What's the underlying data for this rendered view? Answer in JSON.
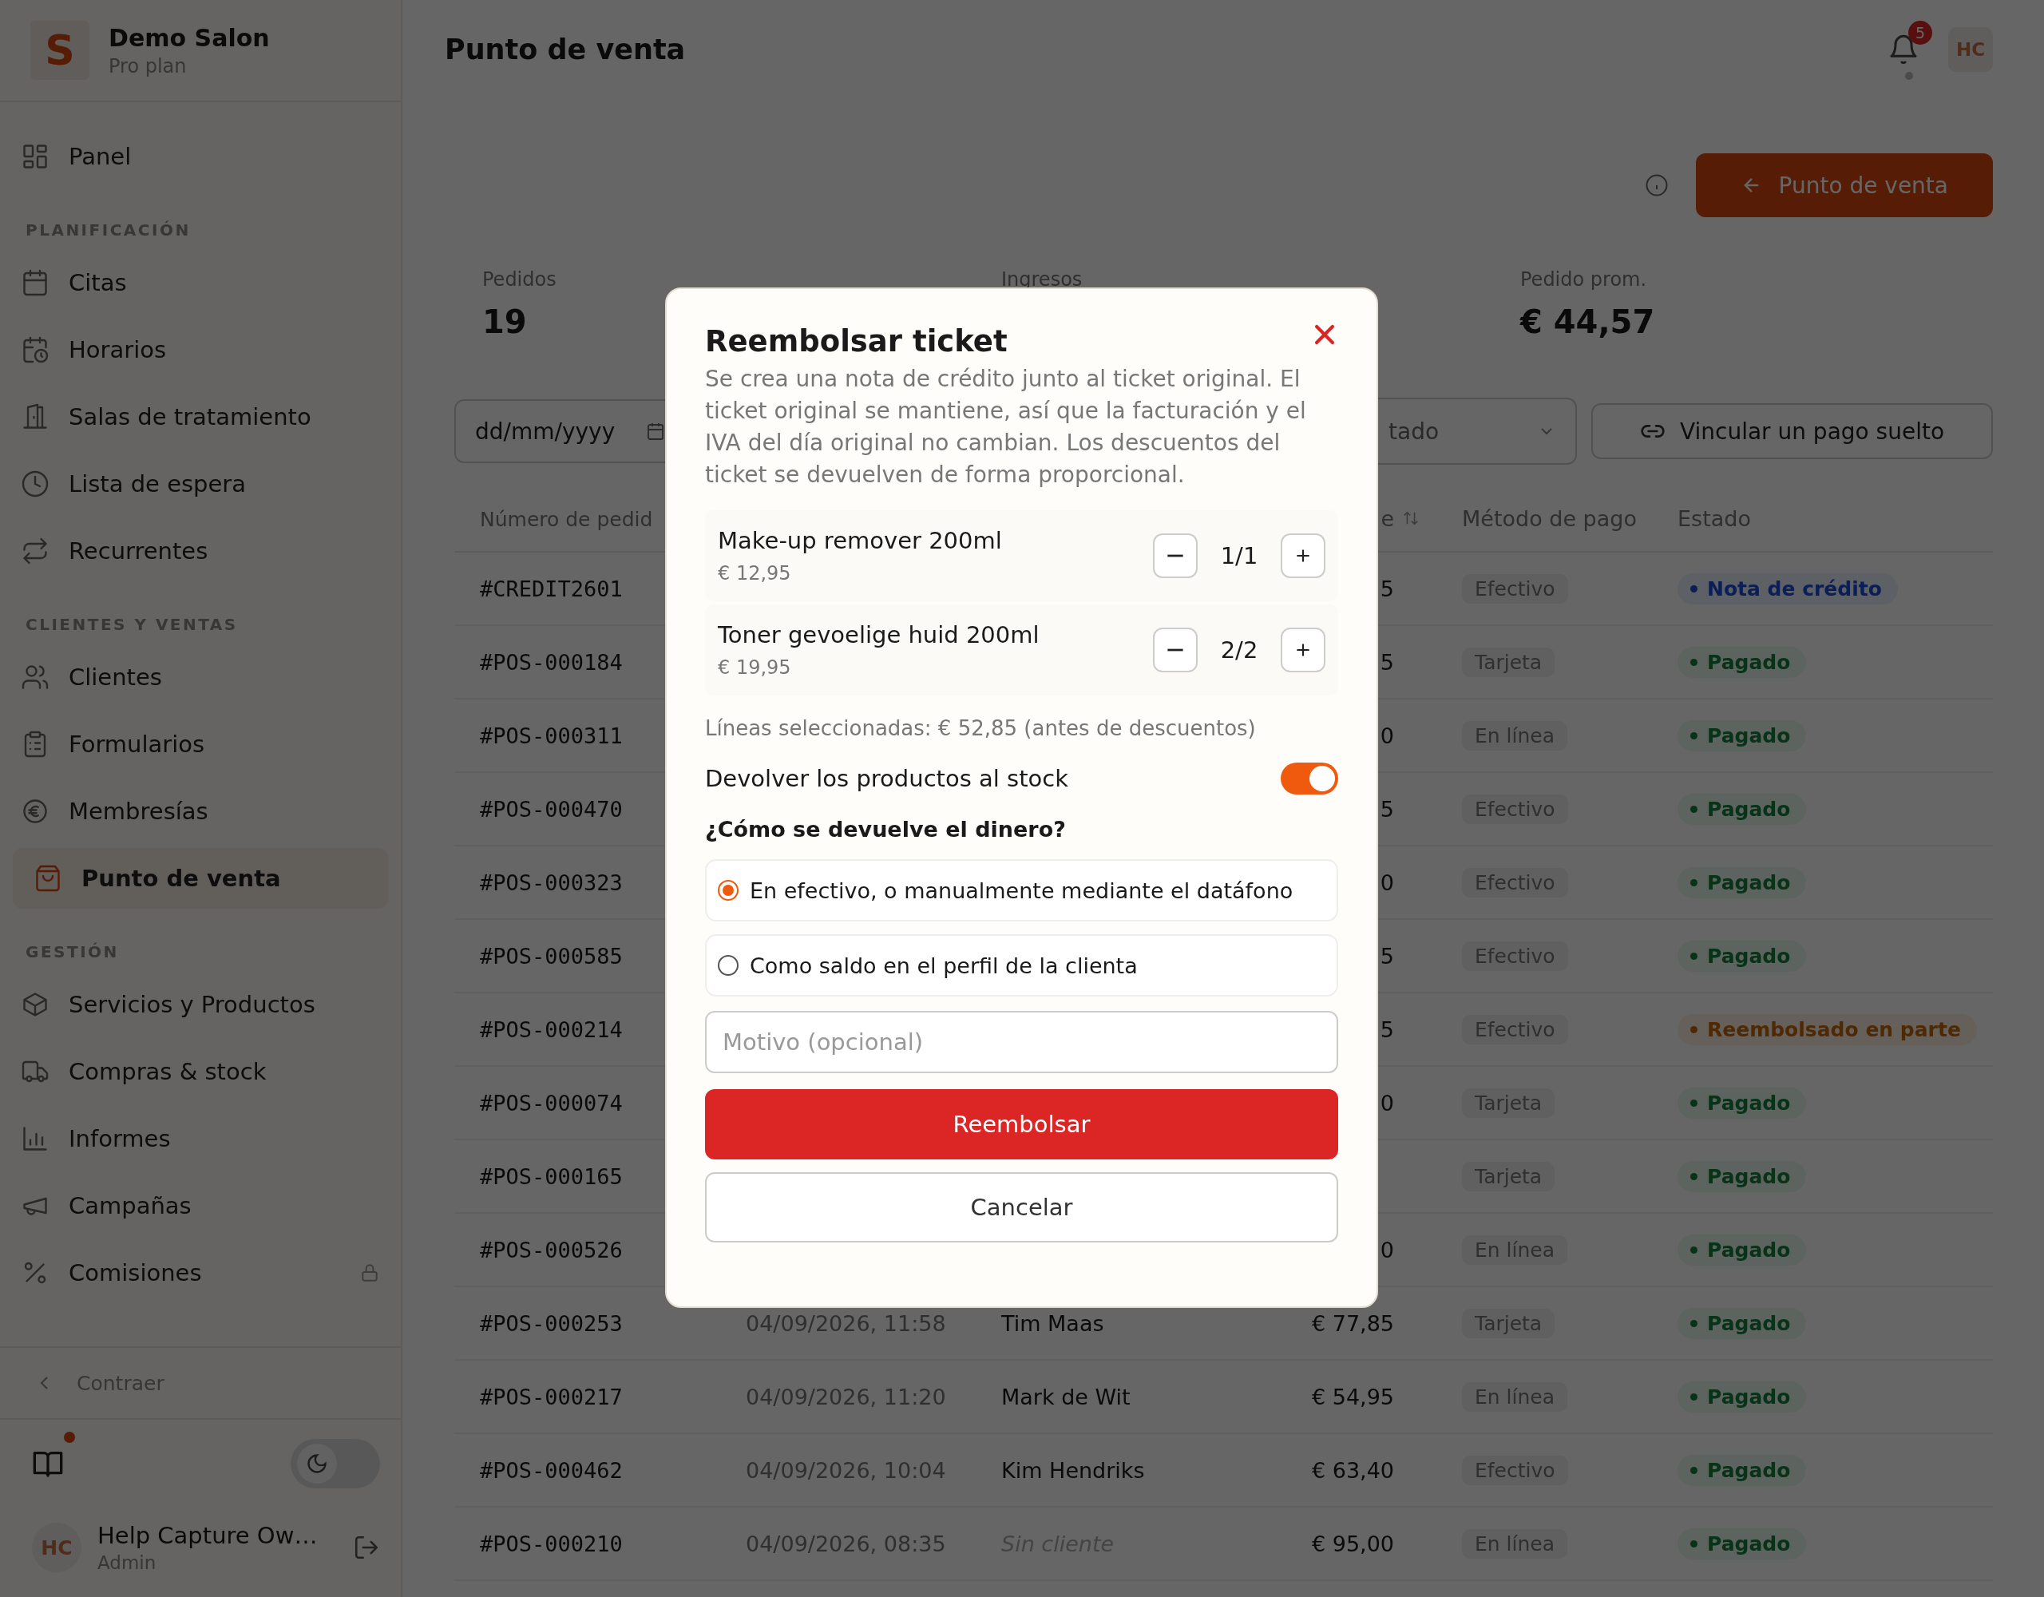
{
  "sidebar": {
    "brand": {
      "logo": "S",
      "name": "Demo Salon",
      "plan": "Pro plan"
    },
    "sections": [
      {
        "items": [
          {
            "label": "Panel",
            "selected": false,
            "locked": false
          }
        ]
      },
      {
        "heading": "PLANIFICACIÓN",
        "items": [
          {
            "label": "Citas",
            "selected": false,
            "locked": false
          },
          {
            "label": "Horarios",
            "selected": false,
            "locked": false
          },
          {
            "label": "Salas de tratamiento",
            "selected": false,
            "locked": false
          },
          {
            "label": "Lista de espera",
            "selected": false,
            "locked": false
          },
          {
            "label": "Recurrentes",
            "selected": false,
            "locked": false
          }
        ]
      },
      {
        "heading": "CLIENTES Y VENTAS",
        "items": [
          {
            "label": "Clientes",
            "selected": false,
            "locked": false
          },
          {
            "label": "Formularios",
            "selected": false,
            "locked": false
          },
          {
            "label": "Membresías",
            "selected": false,
            "locked": false
          },
          {
            "label": "Punto de venta",
            "selected": true,
            "locked": false
          }
        ]
      },
      {
        "heading": "GESTIÓN",
        "items": [
          {
            "label": "Servicios y Productos",
            "selected": false,
            "locked": false
          },
          {
            "label": "Compras & stock",
            "selected": false,
            "locked": false
          },
          {
            "label": "Informes",
            "selected": false,
            "locked": false
          },
          {
            "label": "Campañas",
            "selected": false,
            "locked": false
          },
          {
            "label": "Comisiones",
            "selected": false,
            "locked": true
          }
        ]
      }
    ],
    "collapse": "Contraer",
    "guide_unread": true,
    "dark_mode": false,
    "user": {
      "initials": "HC",
      "name": "Help Capture Ow…",
      "role": "Admin"
    }
  },
  "header": {
    "title": "Punto de venta",
    "notification_count": "5",
    "initials": "HC"
  },
  "primary_button": "Punto de venta",
  "stats": [
    {
      "label": "Pedidos",
      "value": "19"
    },
    {
      "label": "Ingresos"
    },
    {
      "label": "Pedido prom.",
      "value": "€ 44,57"
    }
  ],
  "filters": {
    "date": {
      "placeholder": "dd/mm/yyyy"
    },
    "status": {
      "value": "tado"
    },
    "link_button": "Vincular un pago suelto"
  },
  "table": {
    "columns": {
      "number": "Número de pedid",
      "amount": "e",
      "method": "Método de pago",
      "status": "Estado"
    },
    "rows": [
      {
        "number": "#CREDIT2601",
        "amount": "5",
        "method": "Efectivo",
        "status": {
          "label": "Nota de crédito",
          "kind": "credit"
        }
      },
      {
        "number": "#POS-000184",
        "amount": "5",
        "method": "Tarjeta",
        "status": {
          "label": "Pagado",
          "kind": "paid"
        }
      },
      {
        "number": "#POS-000311",
        "amount": "0",
        "method": "En línea",
        "status": {
          "label": "Pagado",
          "kind": "paid"
        }
      },
      {
        "number": "#POS-000470",
        "amount": "5",
        "method": "Efectivo",
        "status": {
          "label": "Pagado",
          "kind": "paid"
        }
      },
      {
        "number": "#POS-000323",
        "amount": "0",
        "method": "Efectivo",
        "status": {
          "label": "Pagado",
          "kind": "paid"
        }
      },
      {
        "number": "#POS-000585",
        "amount": "5",
        "method": "Efectivo",
        "status": {
          "label": "Pagado",
          "kind": "paid"
        }
      },
      {
        "number": "#POS-000214",
        "amount": "5",
        "method": "Efectivo",
        "status": {
          "label": "Reembolsado en parte",
          "kind": "partial"
        }
      },
      {
        "number": "#POS-000074",
        "amount": "0",
        "method": "Tarjeta",
        "status": {
          "label": "Pagado",
          "kind": "paid"
        }
      },
      {
        "number": "#POS-000165",
        "method": "Tarjeta",
        "status": {
          "label": "Pagado",
          "kind": "paid"
        }
      },
      {
        "number": "#POS-000526",
        "amount": "0",
        "method": "En línea",
        "status": {
          "label": "Pagado",
          "kind": "paid"
        }
      },
      {
        "number": "#POS-000253",
        "date": "04/09/2026, 11:58",
        "client": "Tim Maas",
        "client_placeholder": false,
        "amount": "€ 77,85",
        "method": "Tarjeta",
        "status": {
          "label": "Pagado",
          "kind": "paid"
        }
      },
      {
        "number": "#POS-000217",
        "date": "04/09/2026, 11:20",
        "client": "Mark de Wit",
        "client_placeholder": false,
        "amount": "€ 54,95",
        "method": "En línea",
        "status": {
          "label": "Pagado",
          "kind": "paid"
        }
      },
      {
        "number": "#POS-000462",
        "date": "04/09/2026, 10:04",
        "client": "Kim Hendriks",
        "client_placeholder": false,
        "amount": "€ 63,40",
        "method": "Efectivo",
        "status": {
          "label": "Pagado",
          "kind": "paid"
        }
      },
      {
        "number": "#POS-000210",
        "date": "04/09/2026, 08:35",
        "client": "Sin cliente",
        "client_placeholder": true,
        "amount": "€ 95,00",
        "method": "En línea",
        "status": {
          "label": "Pagado",
          "kind": "paid"
        }
      }
    ]
  },
  "refund_dialog": {
    "title": "Reembolsar ticket",
    "description": "Se crea una nota de crédito junto al ticket original. El ticket original se mantiene, así que la facturación y el IVA del día original no cambian. Los descuentos del ticket se devuelven de forma proporcional.",
    "lines": [
      {
        "name": "Make-up remover 200ml",
        "price": "€ 12,95",
        "quantity": "1/1"
      },
      {
        "name": "Toner gevoelige huid 200ml",
        "price": "€ 19,95",
        "quantity": "2/2"
      }
    ],
    "summary": "Líneas seleccionadas: € 52,85 (antes de descuentos)",
    "restock": {
      "label": "Devolver los productos al stock",
      "on": true
    },
    "question": "¿Cómo se devuelve el dinero?",
    "options": [
      {
        "label": "En efectivo, o manualmente mediante el datáfono",
        "selected": true
      },
      {
        "label": "Como saldo en el perfil de la clienta",
        "selected": false
      }
    ],
    "reason": {
      "placeholder": "Motivo (opcional)"
    },
    "buttons": [
      {
        "label": "Reembolsar",
        "kind": "primary"
      },
      {
        "label": "Cancelar",
        "kind": "secondary"
      }
    ]
  }
}
